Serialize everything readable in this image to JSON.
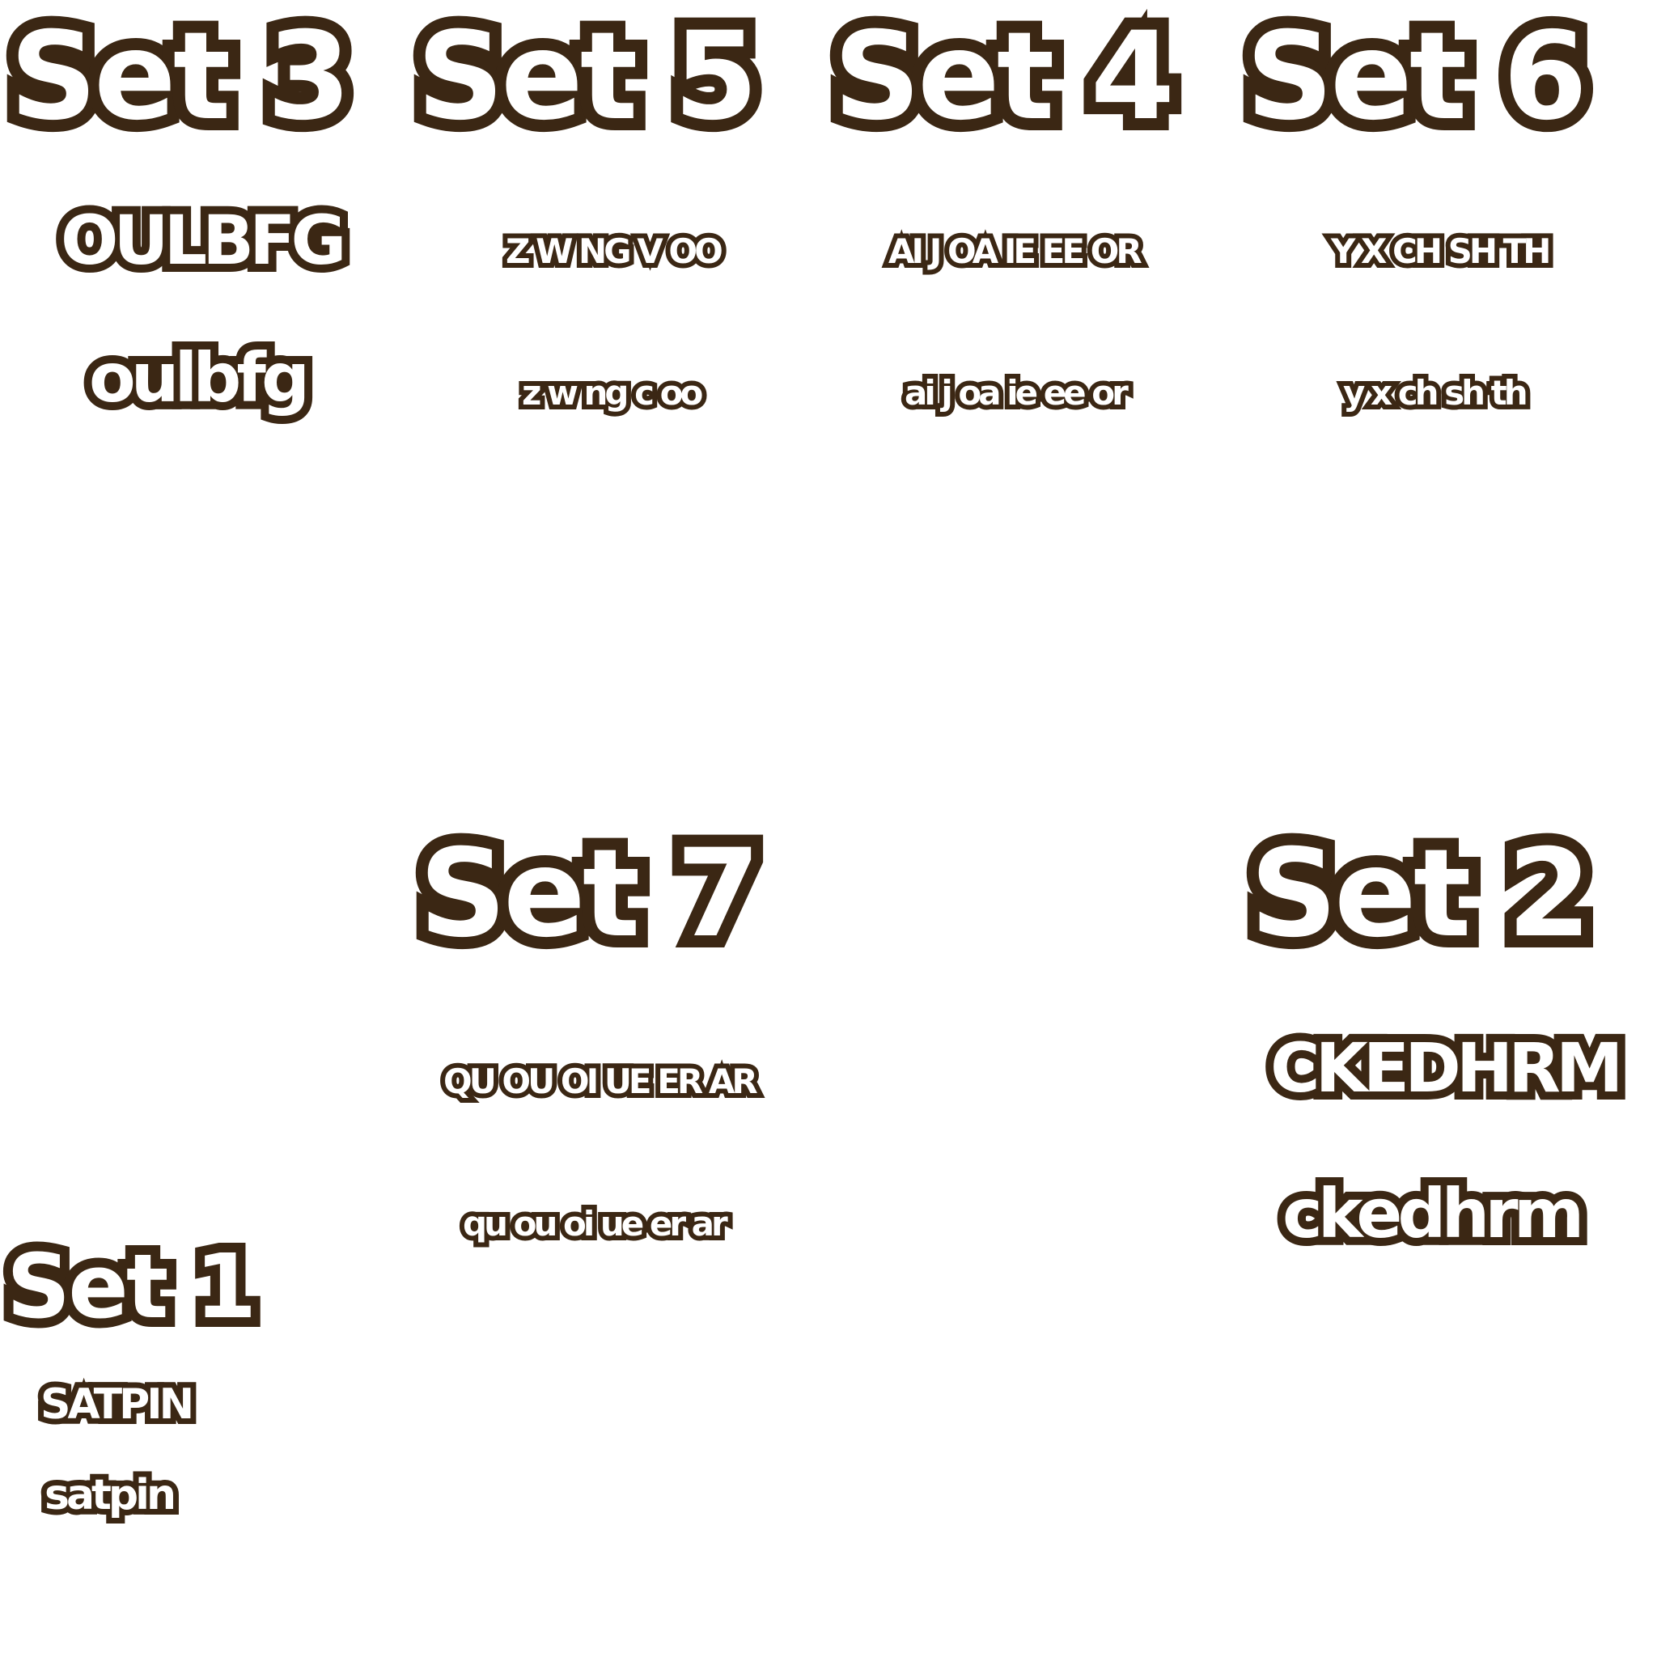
{
  "stroke_color": "#3b2714",
  "fill_color": "#ffffff",
  "sets": {
    "set3": {
      "title": "Set 3",
      "upper": "OULBFG",
      "lower": "oulbfg"
    },
    "set5": {
      "title": "Set 5",
      "upper": "Z W NG V OO",
      "lower": "z w ng c oo"
    },
    "set4": {
      "title": "Set 4",
      "upper": "AI J OA IE EE OR",
      "lower": "ai j oa ie ee or"
    },
    "set6": {
      "title": "Set 6",
      "upper": "Y X CH SH TH",
      "lower": "y x ch sh th"
    },
    "set7": {
      "title": "Set 7",
      "upper": "QU OU OI UE ER AR",
      "lower": "qu ou oi ue er ar"
    },
    "set2": {
      "title": "Set 2",
      "upper": "CKEDHRM",
      "lower": "ckedhrm"
    },
    "set1": {
      "title": "Set 1",
      "upper": "SATPIN",
      "lower": "satpin"
    }
  }
}
